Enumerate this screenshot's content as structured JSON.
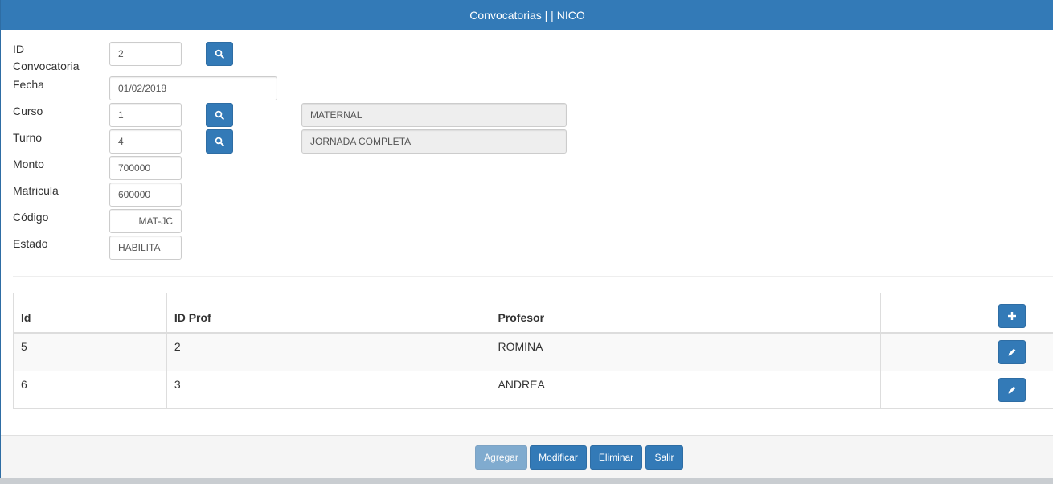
{
  "window": {
    "title": "Convocatorias | | NICO"
  },
  "form": {
    "id_label": "ID",
    "id_label2": "Convocatoria",
    "id_value": "2",
    "fecha_label": "Fecha",
    "fecha_value": "01/02/2018",
    "curso_label": "Curso",
    "curso_value": "1",
    "curso_desc": "MATERNAL",
    "turno_label": "Turno",
    "turno_value": "4",
    "turno_desc": "JORNADA COMPLETA",
    "monto_label": "Monto",
    "monto_value": "700000",
    "matricula_label": "Matricula",
    "matricula_value": "600000",
    "codigo_label": "Código",
    "codigo_value": "MAT-JC",
    "estado_label": "Estado",
    "estado_value": "HABILITA"
  },
  "table": {
    "headers": [
      "Id",
      "ID Prof",
      "Profesor"
    ],
    "rows": [
      {
        "id": "5",
        "id_prof": "2",
        "profesor": "ROMINA"
      },
      {
        "id": "6",
        "id_prof": "3",
        "profesor": "ANDREA"
      }
    ]
  },
  "footer": {
    "agregar": "Agregar",
    "modificar": "Modificar",
    "eliminar": "Eliminar",
    "salir": "Salir"
  },
  "icons": {
    "search": "search-icon",
    "add": "plus-icon",
    "edit": "pencil-icon"
  },
  "colors": {
    "primary": "#337ab7",
    "primary_border": "#2e6da4",
    "readonly_bg": "#eeeeee"
  }
}
